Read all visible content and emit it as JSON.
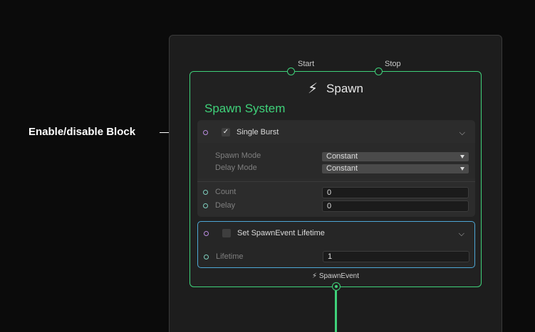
{
  "annotation": {
    "label": "Enable/disable Block"
  },
  "node": {
    "flow_inputs": [
      "Start",
      "Stop"
    ],
    "icon": "lightning-bolt-icon",
    "title": "Spawn",
    "context_title": "Spawn System",
    "output_label": "SpawnEvent",
    "accent_color": "#3fd27a"
  },
  "blocks": [
    {
      "name": "Single Burst",
      "enabled": true,
      "settings": [
        {
          "label": "Spawn Mode",
          "value": "Constant"
        },
        {
          "label": "Delay Mode",
          "value": "Constant"
        }
      ],
      "properties": [
        {
          "label": "Count",
          "value": "0"
        },
        {
          "label": "Delay",
          "value": "0"
        }
      ]
    },
    {
      "name": "Set SpawnEvent Lifetime",
      "enabled": false,
      "selected_color": "#4ea7d6",
      "properties": [
        {
          "label": "Lifetime",
          "value": "1"
        }
      ]
    }
  ]
}
